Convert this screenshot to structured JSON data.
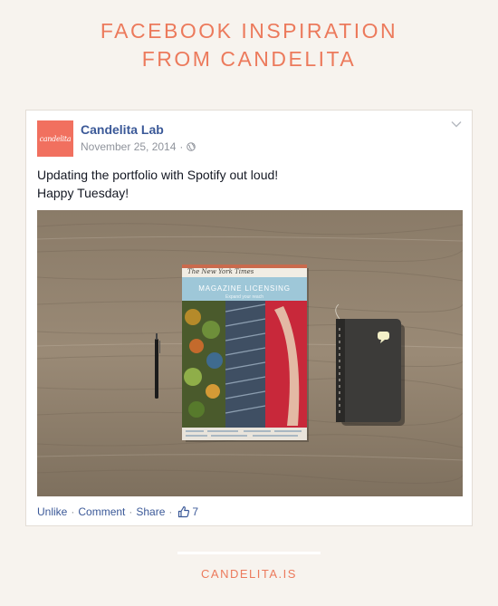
{
  "header": {
    "line1": "FACEBOOK INSPIRATION",
    "line2": "FROM CANDELITA"
  },
  "post": {
    "avatar_text": "candelita",
    "page_name": "Candelita Lab",
    "date": "November 25, 2014",
    "separator": "·",
    "text_line1": "Updating the portfolio with Spotify out loud!",
    "text_line2": "Happy Tuesday!",
    "photo": {
      "magazine_masthead": "The New York Times",
      "magazine_title": "MAGAZINE LICENSING",
      "magazine_subtitle": "Expand your reach"
    },
    "actions": {
      "unlike": "Unlike",
      "comment": "Comment",
      "share": "Share",
      "like_count": "7"
    }
  },
  "footer": {
    "site": "CANDELITA.IS"
  },
  "colors": {
    "accent": "#ec7a5c",
    "link": "#3b5998",
    "background": "#f7f3ee"
  },
  "icons": [
    "globe-icon",
    "chevron-down-icon",
    "thumbs-up-icon"
  ]
}
